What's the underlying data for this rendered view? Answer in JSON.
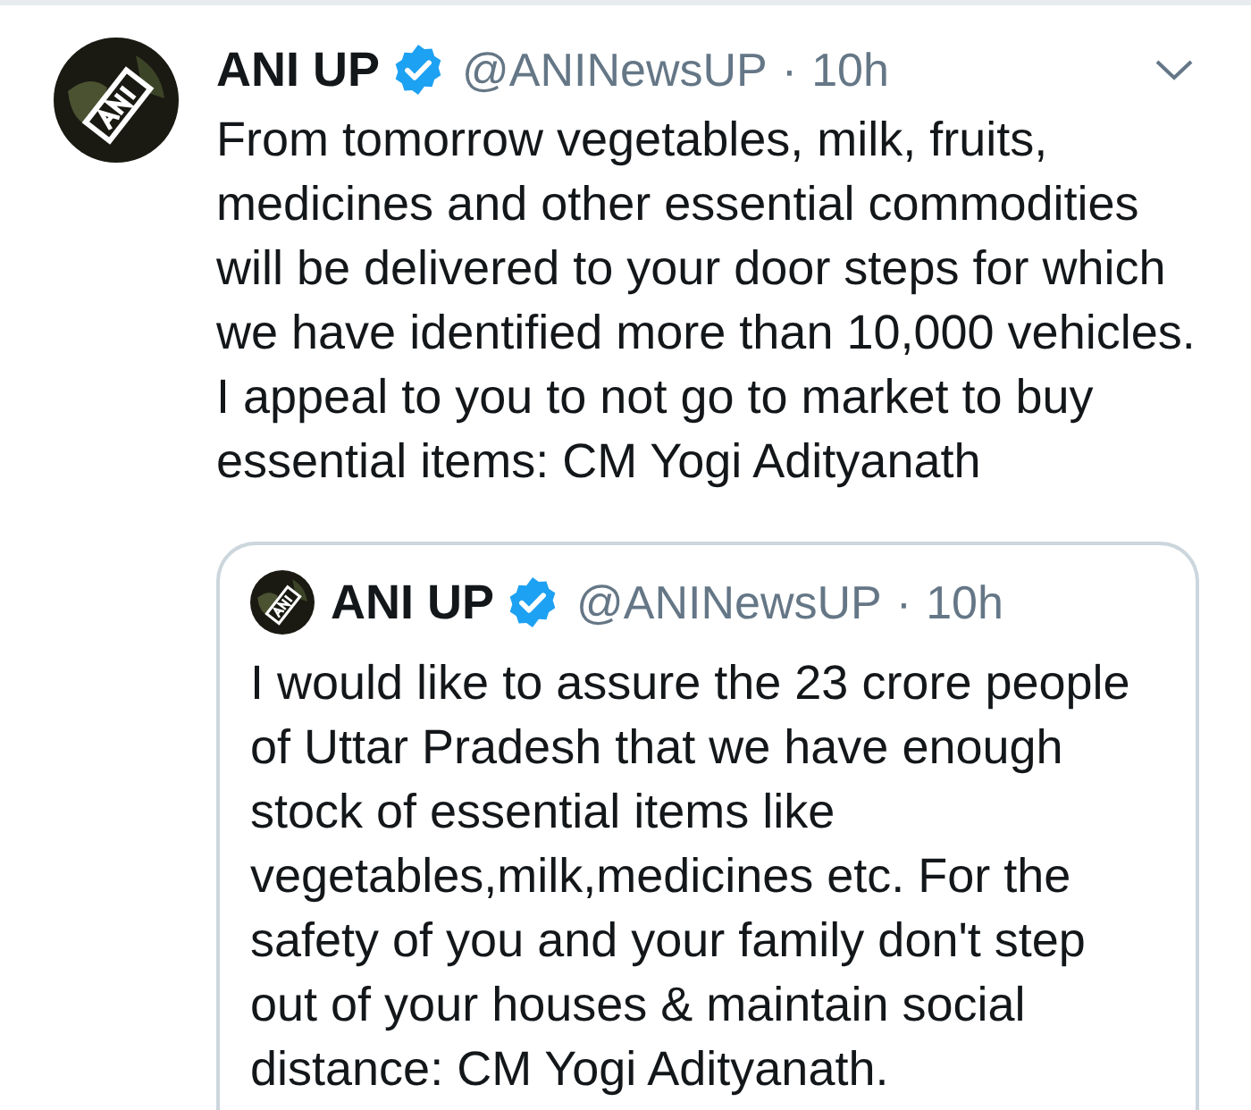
{
  "tweet": {
    "author": {
      "name": "ANI UP",
      "verified": true,
      "handle": "@ANINewsUP",
      "separator": "·",
      "time": "10h"
    },
    "text": "From tomorrow vegetables, milk, fruits, medicines and other essential commodities will be delivered to your door steps for which we have identified more than 10,000 vehicles. I appeal to you to not go to market to buy essential items: CM Yogi Adityanath",
    "quoted_tweet": {
      "author": {
        "name": "ANI UP",
        "verified": true,
        "handle": "@ANINewsUP",
        "separator": "·",
        "time": "10h"
      },
      "text": "I would like to assure the 23 crore people of Uttar Pradesh that we have enough stock of essential items like vegetables,milk,medicines etc. For the safety of you and your family don't step out of your houses & maintain social distance: CM Yogi Adityanath."
    }
  }
}
